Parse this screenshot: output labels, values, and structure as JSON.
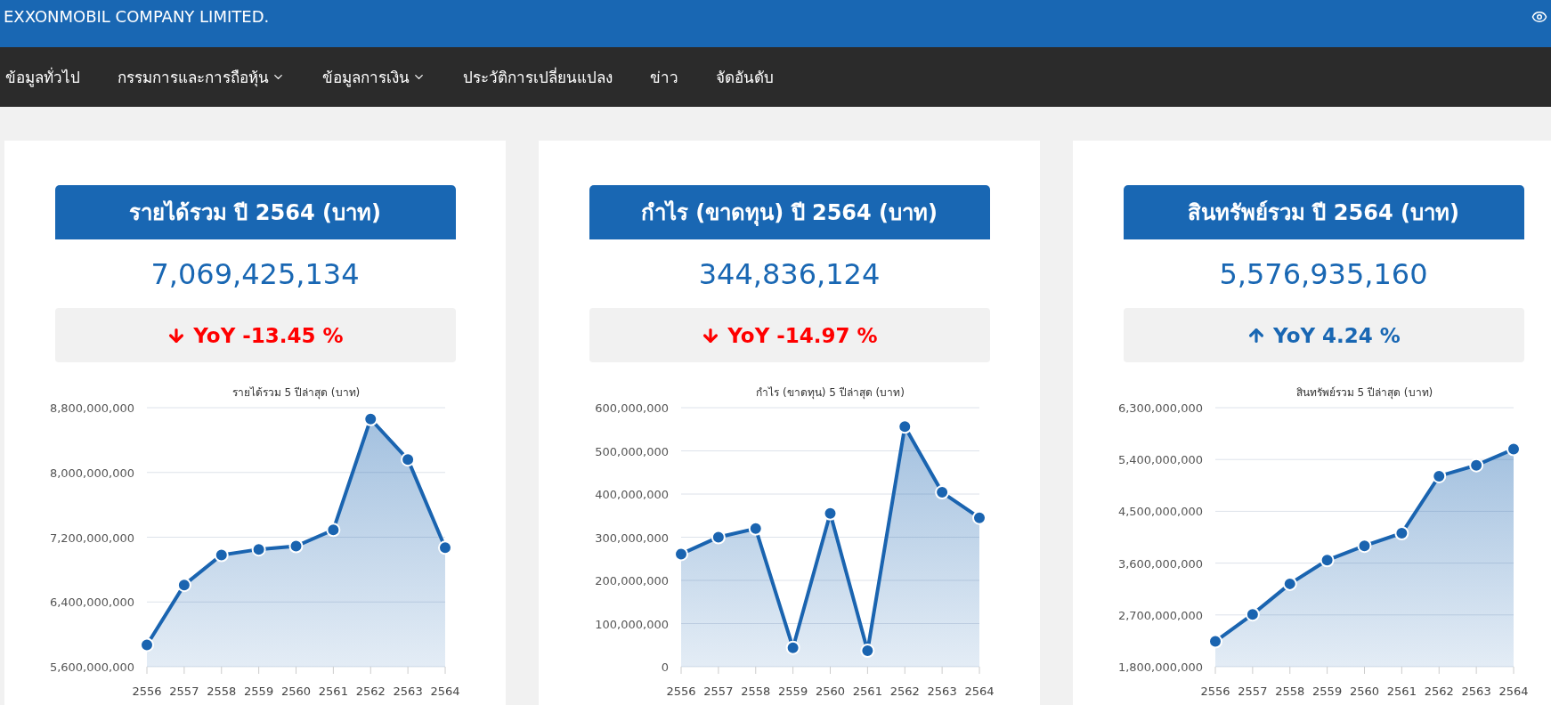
{
  "header": {
    "title": "EXXONMOBIL COMPANY LIMITED."
  },
  "nav": [
    {
      "label": "ข้อมูลทั่วไป",
      "has_dropdown": false
    },
    {
      "label": "กรรมการและการถือหุ้น",
      "has_dropdown": true
    },
    {
      "label": "ข้อมูลการเงิน",
      "has_dropdown": true
    },
    {
      "label": "ประวัติการเปลี่ยนแปลง",
      "has_dropdown": false
    },
    {
      "label": "ข่าว",
      "has_dropdown": false
    },
    {
      "label": "จัดอันดับ",
      "has_dropdown": false
    }
  ],
  "cards": [
    {
      "title": "รายได้รวม ปี 2564 (บาท)",
      "value": "7,069,425,134",
      "yoy": {
        "kind": "down",
        "text": "YoY -13.45 %"
      },
      "chart_data": {
        "type": "area",
        "title": "รายได้รวม 5 ปีล่าสุด (บาท)",
        "categories": [
          "2556",
          "2557",
          "2558",
          "2559",
          "2560",
          "2561",
          "2562",
          "2563",
          "2564"
        ],
        "series": [
          {
            "color": "#1a64b0",
            "values": [
              5870000000,
              6610000000,
              6980000000,
              7050000000,
              7090000000,
              7290000000,
              8660000000,
              8160000000,
              7070000000
            ]
          }
        ],
        "ylim": [
          5600000000,
          8800000000
        ],
        "grid": true,
        "yticks": [
          {
            "value": 5600000000,
            "label": "5,600,000,000"
          },
          {
            "value": 6400000000,
            "label": "6,400,000,000"
          },
          {
            "value": 7200000000,
            "label": "7,200,000,000"
          },
          {
            "value": 8000000000,
            "label": "8,000,000,000"
          },
          {
            "value": 8800000000,
            "label": "8,800,000,000"
          }
        ]
      }
    },
    {
      "title": "กำไร (ขาดทุน) ปี 2564 (บาท)",
      "value": "344,836,124",
      "yoy": {
        "kind": "down",
        "text": "YoY -14.97 %"
      },
      "chart_data": {
        "type": "area",
        "title": "กำไร (ขาดทุน) 5 ปีล่าสุด (บาท)",
        "categories": [
          "2556",
          "2557",
          "2558",
          "2559",
          "2560",
          "2561",
          "2562",
          "2563",
          "2564"
        ],
        "series": [
          {
            "color": "#1a64b0",
            "values": [
              261000000,
              300000000,
              320000000,
              44000000,
              355000000,
              37000000,
              556000000,
              404000000,
              345000000
            ]
          }
        ],
        "ylim": [
          0,
          600000000
        ],
        "grid": true,
        "yticks": [
          {
            "value": 0,
            "label": "0"
          },
          {
            "value": 100000000,
            "label": "100,000,000"
          },
          {
            "value": 200000000,
            "label": "200,000,000"
          },
          {
            "value": 300000000,
            "label": "300,000,000"
          },
          {
            "value": 400000000,
            "label": "400,000,000"
          },
          {
            "value": 500000000,
            "label": "500,000,000"
          },
          {
            "value": 600000000,
            "label": "600,000,000"
          }
        ]
      }
    },
    {
      "title": "สินทรัพย์รวม ปี 2564 (บาท)",
      "value": "5,576,935,160",
      "yoy": {
        "kind": "up",
        "text": "YoY 4.24 %"
      },
      "chart_data": {
        "type": "area",
        "title": "สินทรัพย์รวม 5 ปีล่าสุด (บาท)",
        "categories": [
          "2556",
          "2557",
          "2558",
          "2559",
          "2560",
          "2561",
          "2562",
          "2563",
          "2564"
        ],
        "series": [
          {
            "color": "#1a64b0",
            "values": [
              2240000000,
              2710000000,
              3240000000,
              3650000000,
              3900000000,
              4120000000,
              5110000000,
              5300000000,
              5580000000
            ]
          }
        ],
        "ylim": [
          1800000000,
          6300000000
        ],
        "grid": true,
        "yticks": [
          {
            "value": 1800000000,
            "label": "1,800,000,000"
          },
          {
            "value": 2700000000,
            "label": "2,700,000,000"
          },
          {
            "value": 3600000000,
            "label": "3,600,000,000"
          },
          {
            "value": 4500000000,
            "label": "4,500,000,000"
          },
          {
            "value": 5400000000,
            "label": "5,400,000,000"
          },
          {
            "value": 6300000000,
            "label": "6,300,000,000"
          }
        ]
      }
    }
  ]
}
